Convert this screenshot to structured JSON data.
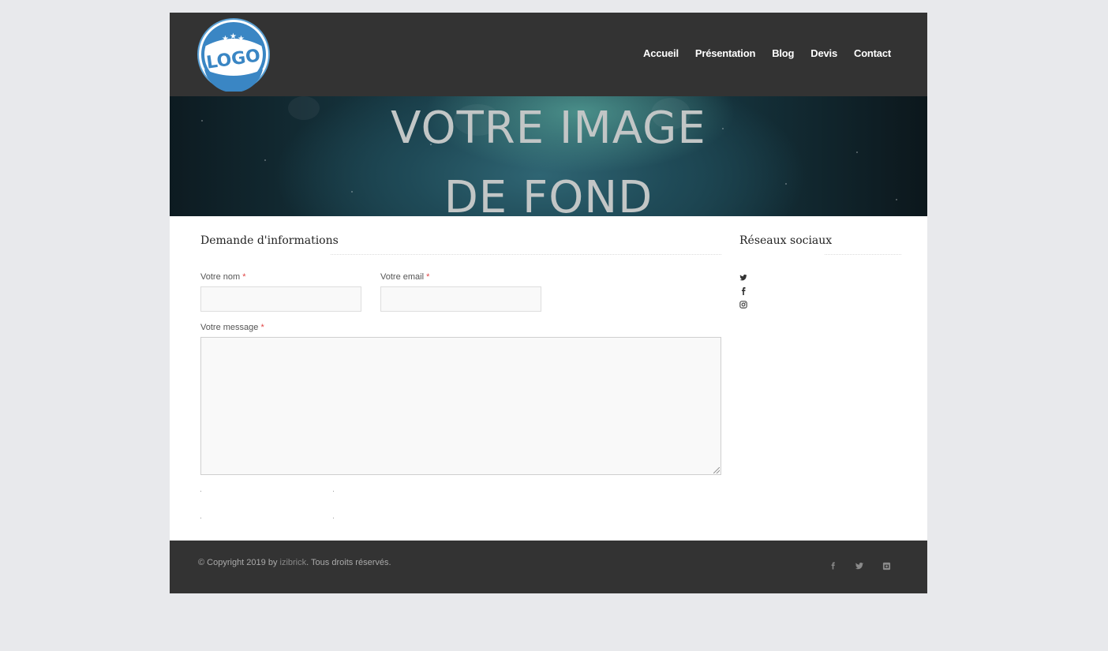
{
  "header": {
    "logo_text": "LOGO",
    "nav": [
      "Accueil",
      "Présentation",
      "Blog",
      "Devis",
      "Contact"
    ]
  },
  "banner": {
    "line1": "VOTRE IMAGE",
    "line2": "DE FOND"
  },
  "form": {
    "title": "Demande d'informations",
    "name_label": "Votre nom",
    "email_label": "Votre email",
    "message_label": "Votre message",
    "required_mark": "*",
    "name_value": "",
    "email_value": "",
    "message_value": ""
  },
  "sidebar": {
    "title": "Réseaux sociaux",
    "icons": [
      "twitter-icon",
      "facebook-icon",
      "instagram-icon"
    ]
  },
  "footer": {
    "copyright_prefix": "© Copyright 2019 by",
    "brand": "izibrick",
    "copyright_suffix": ". Tous droits réservés.",
    "icons": [
      "facebook-icon",
      "twitter-icon",
      "instagram-icon"
    ]
  },
  "colors": {
    "header_bg": "#333333",
    "logo_blue": "#3a86c4",
    "required": "#e14444"
  }
}
